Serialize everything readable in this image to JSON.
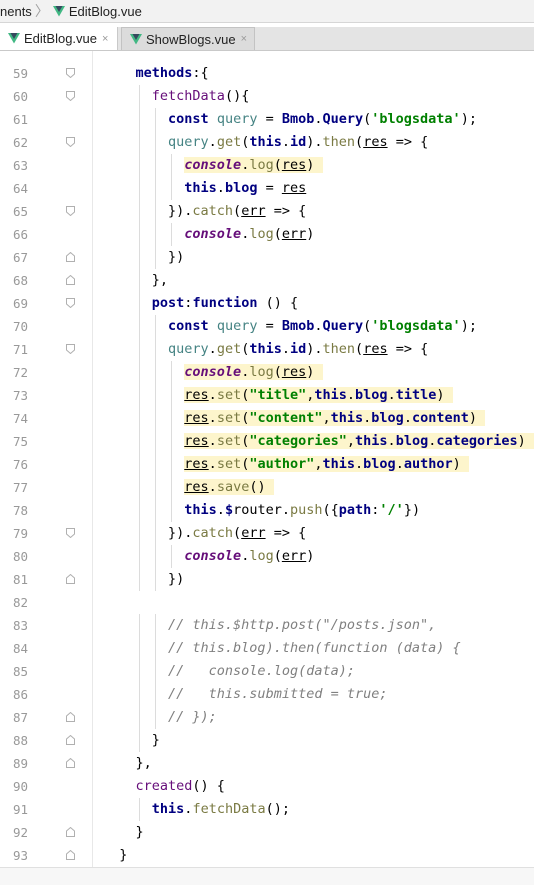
{
  "breadcrumb": {
    "segment_prev": "nents",
    "file": "EditBlog.vue"
  },
  "tabs": [
    {
      "label": "EditBlog.vue",
      "close": "×",
      "active": true
    },
    {
      "label": "ShowBlogs.vue",
      "close": "×",
      "active": false
    }
  ],
  "colors": {
    "keyword": "#000080",
    "string": "#008000",
    "property": "#660e7a",
    "method": "#7a7a43",
    "variable": "#458383",
    "comment": "#808080",
    "line_number": "#999999",
    "vue_green": "#41b883",
    "vue_dark": "#35495e"
  },
  "lines": [
    {
      "n": "59",
      "t": "    methods:{"
    },
    {
      "n": "60",
      "t": "      fetchData(){"
    },
    {
      "n": "61",
      "t": "        const query = Bmob.Query('blogsdata');"
    },
    {
      "n": "62",
      "t": "        query.get(this.id).then(res => {"
    },
    {
      "n": "63",
      "t": "          console.log(res)"
    },
    {
      "n": "64",
      "t": "          this.blog = res"
    },
    {
      "n": "65",
      "t": "        }).catch(err => {"
    },
    {
      "n": "66",
      "t": "          console.log(err)"
    },
    {
      "n": "67",
      "t": "        })"
    },
    {
      "n": "68",
      "t": "      },"
    },
    {
      "n": "69",
      "t": "      post:function () {"
    },
    {
      "n": "70",
      "t": "        const query = Bmob.Query('blogsdata');"
    },
    {
      "n": "71",
      "t": "        query.get(this.id).then(res => {"
    },
    {
      "n": "72",
      "t": "          console.log(res)"
    },
    {
      "n": "73",
      "t": "          res.set(\"title\",this.blog.title)"
    },
    {
      "n": "74",
      "t": "          res.set(\"content\",this.blog.content)"
    },
    {
      "n": "75",
      "t": "          res.set(\"categories\",this.blog.categories)"
    },
    {
      "n": "76",
      "t": "          res.set(\"author\",this.blog.author)"
    },
    {
      "n": "77",
      "t": "          res.save()"
    },
    {
      "n": "78",
      "t": "          this.$router.push({path:'/'})"
    },
    {
      "n": "79",
      "t": "        }).catch(err => {"
    },
    {
      "n": "80",
      "t": "          console.log(err)"
    },
    {
      "n": "81",
      "t": "        })"
    },
    {
      "n": "82",
      "t": ""
    },
    {
      "n": "83",
      "t": "        // this.$http.post(\"/posts.json\","
    },
    {
      "n": "84",
      "t": "        // this.blog).then(function (data) {"
    },
    {
      "n": "85",
      "t": "        //   console.log(data);"
    },
    {
      "n": "86",
      "t": "        //   this.submitted = true;"
    },
    {
      "n": "87",
      "t": "        // });"
    },
    {
      "n": "88",
      "t": "      }"
    },
    {
      "n": "89",
      "t": "    },"
    },
    {
      "n": "90",
      "t": "    created() {"
    },
    {
      "n": "91",
      "t": "      this.fetchData();"
    },
    {
      "n": "92",
      "t": "    }"
    },
    {
      "n": "93",
      "t": "  }"
    }
  ]
}
